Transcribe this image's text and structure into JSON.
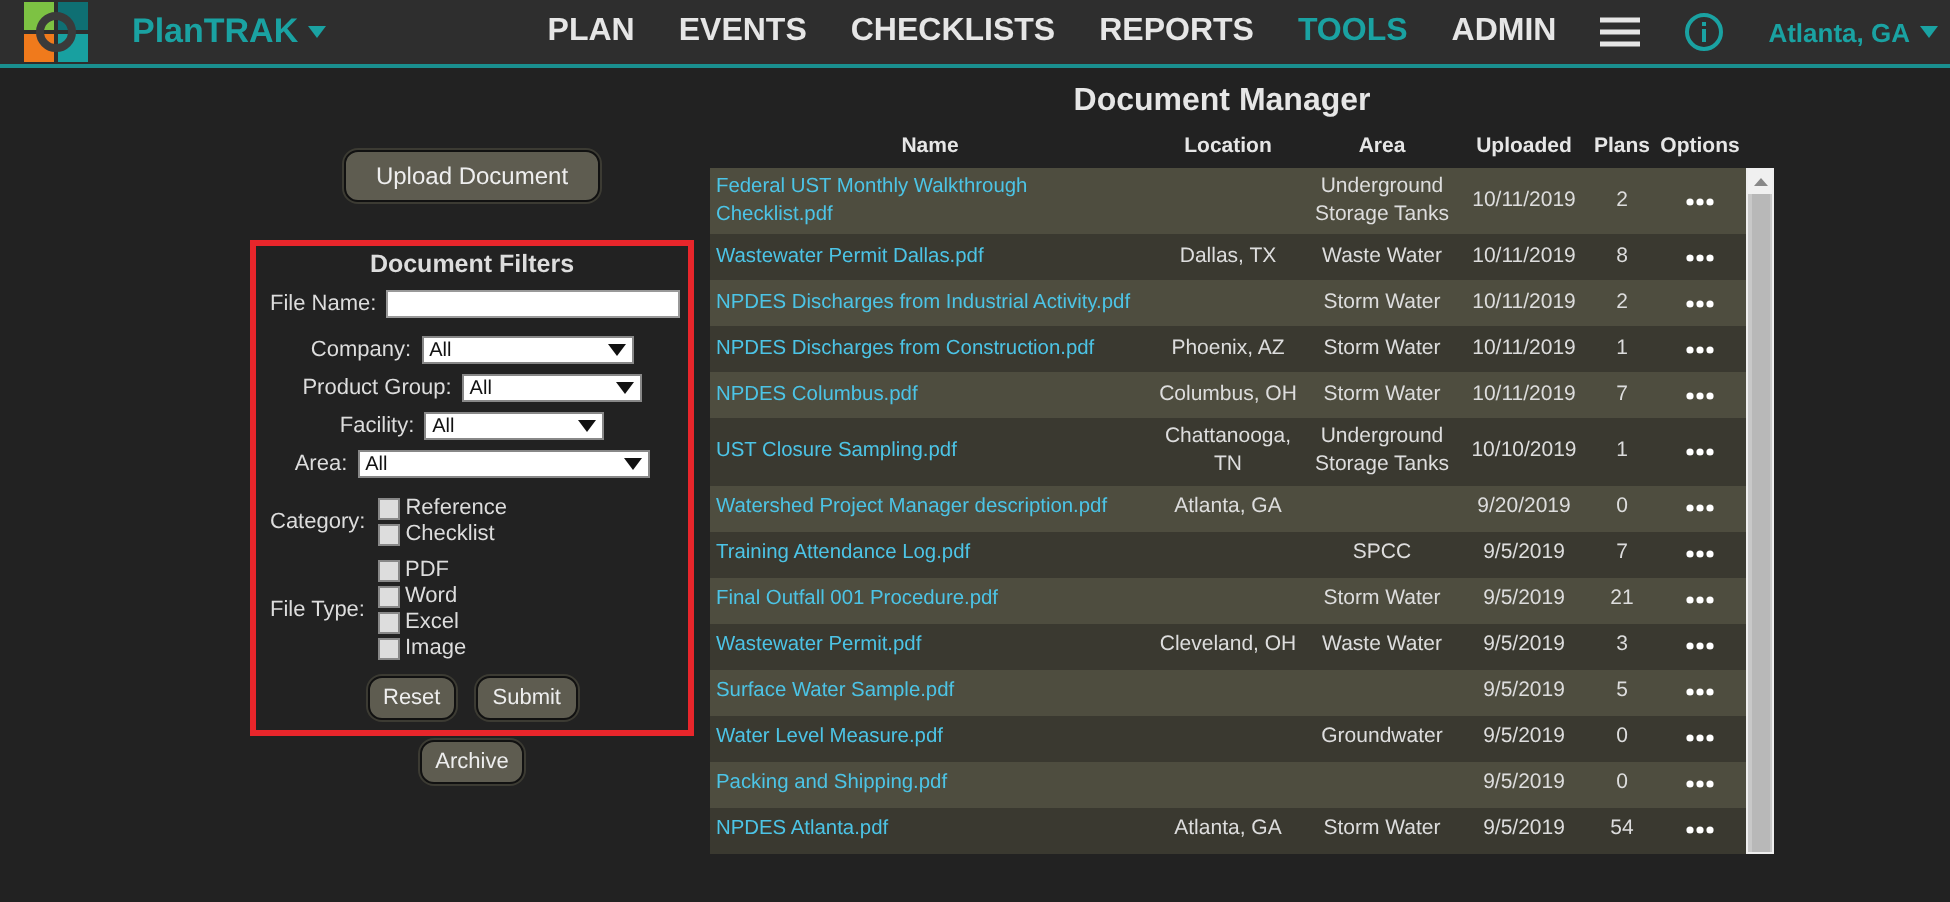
{
  "app": {
    "name": "PlanTRAK",
    "location": "Atlanta, GA"
  },
  "nav": [
    {
      "label": "PLAN",
      "selected": false
    },
    {
      "label": "EVENTS",
      "selected": false
    },
    {
      "label": "CHECKLISTS",
      "selected": false
    },
    {
      "label": "REPORTS",
      "selected": false
    },
    {
      "label": "TOOLS",
      "selected": true
    },
    {
      "label": "ADMIN",
      "selected": false
    }
  ],
  "upload_button": "Upload Document",
  "filters": {
    "title": "Document Filters",
    "fields": [
      {
        "kind": "text",
        "label": "File Name:"
      },
      {
        "kind": "select",
        "label": "Company:",
        "value": "All"
      },
      {
        "kind": "select",
        "label": "Product Group:",
        "value": "All"
      },
      {
        "kind": "select",
        "label": "Facility:",
        "value": "All"
      },
      {
        "kind": "select",
        "label": "Area:",
        "value": "All"
      }
    ],
    "groups": [
      {
        "label": "Category:",
        "options": [
          {
            "label": "Reference",
            "checked": false
          },
          {
            "label": "Checklist",
            "checked": false
          }
        ]
      },
      {
        "label": "File Type:",
        "options": [
          {
            "label": "PDF",
            "checked": false
          },
          {
            "label": "Word",
            "checked": false
          },
          {
            "label": "Excel",
            "checked": false
          },
          {
            "label": "Image",
            "checked": false
          }
        ]
      }
    ],
    "buttons": [
      "Reset",
      "Submit"
    ]
  },
  "archive_button": "Archive",
  "table": {
    "title": "Document Manager",
    "columns": [
      "Name",
      "Location",
      "Area",
      "Uploaded",
      "Plans",
      "Options"
    ],
    "rows": [
      {
        "name": "Federal UST Monthly Walkthrough Checklist.pdf",
        "location": "",
        "area": "Underground Storage Tanks",
        "uploaded": "10/11/2019",
        "plans": "2"
      },
      {
        "name": "Wastewater Permit Dallas.pdf",
        "location": "Dallas, TX",
        "area": "Waste Water",
        "uploaded": "10/11/2019",
        "plans": "8"
      },
      {
        "name": "NPDES Discharges from Industrial Activity.pdf",
        "location": "",
        "area": "Storm Water",
        "uploaded": "10/11/2019",
        "plans": "2"
      },
      {
        "name": "NPDES Discharges from Construction.pdf",
        "location": "Phoenix, AZ",
        "area": "Storm Water",
        "uploaded": "10/11/2019",
        "plans": "1"
      },
      {
        "name": "NPDES Columbus.pdf",
        "location": "Columbus, OH",
        "area": "Storm Water",
        "uploaded": "10/11/2019",
        "plans": "7"
      },
      {
        "name": "UST Closure Sampling.pdf",
        "location": "Chattanooga, TN",
        "area": "Underground Storage Tanks",
        "uploaded": "10/10/2019",
        "plans": "1"
      },
      {
        "name": "Watershed Project Manager description.pdf",
        "location": "Atlanta, GA",
        "area": "",
        "uploaded": "9/20/2019",
        "plans": "0"
      },
      {
        "name": "Training Attendance Log.pdf",
        "location": "",
        "area": "SPCC",
        "uploaded": "9/5/2019",
        "plans": "7"
      },
      {
        "name": "Final Outfall 001 Procedure.pdf",
        "location": "",
        "area": "Storm Water",
        "uploaded": "9/5/2019",
        "plans": "21"
      },
      {
        "name": "Wastewater Permit.pdf",
        "location": "Cleveland, OH",
        "area": "Waste Water",
        "uploaded": "9/5/2019",
        "plans": "3"
      },
      {
        "name": "Surface Water Sample.pdf",
        "location": "",
        "area": "",
        "uploaded": "9/5/2019",
        "plans": "5"
      },
      {
        "name": "Water Level Measure.pdf",
        "location": "",
        "area": "Groundwater",
        "uploaded": "9/5/2019",
        "plans": "0"
      },
      {
        "name": "Packing and Shipping.pdf",
        "location": "",
        "area": "",
        "uploaded": "9/5/2019",
        "plans": "0"
      },
      {
        "name": "NPDES Atlanta.pdf",
        "location": "Atlanta, GA",
        "area": "Storm Water",
        "uploaded": "9/5/2019",
        "plans": "54"
      }
    ]
  }
}
